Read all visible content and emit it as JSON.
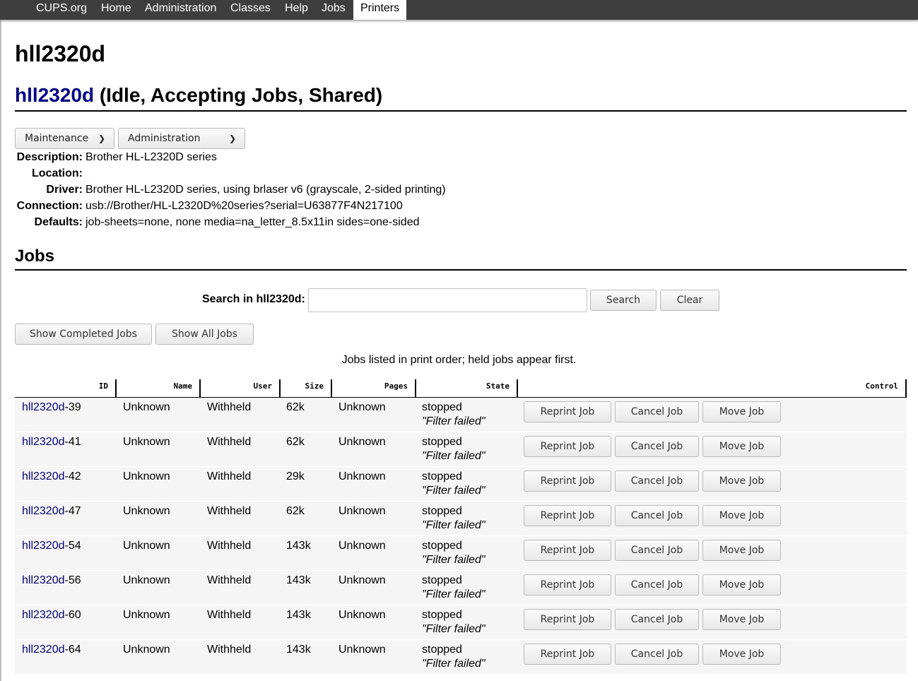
{
  "nav": {
    "items": [
      "CUPS.org",
      "Home",
      "Administration",
      "Classes",
      "Help",
      "Jobs",
      "Printers"
    ],
    "active": "Printers"
  },
  "page_title": "hll2320d",
  "printer": {
    "name": "hll2320d",
    "status": " (Idle, Accepting Jobs, Shared)"
  },
  "selects": {
    "maintenance": "Maintenance",
    "administration": "Administration"
  },
  "info": {
    "description_label": "Description:",
    "description": "Brother HL-L2320D series",
    "location_label": "Location:",
    "location": "",
    "driver_label": "Driver:",
    "driver": "Brother HL-L2320D series, using brlaser v6 (grayscale, 2-sided printing)",
    "connection_label": "Connection:",
    "connection": "usb://Brother/HL-L2320D%20series?serial=U63877F4N217100",
    "defaults_label": "Defaults:",
    "defaults": "job-sheets=none, none media=na_letter_8.5x11in sides=one-sided"
  },
  "jobs_heading": "Jobs",
  "search": {
    "label": "Search in hll2320d:",
    "value": "",
    "search_button": "Search",
    "clear_button": "Clear"
  },
  "show_completed_button": "Show Completed Jobs",
  "show_all_button": "Show All Jobs",
  "jobs_note": "Jobs listed in print order; held jobs appear first.",
  "table": {
    "headers": [
      "ID",
      "Name",
      "User",
      "Size",
      "Pages",
      "State",
      "Control"
    ],
    "rows": [
      {
        "id_prefix": "hll2320d",
        "id_num": "-39",
        "name": "Unknown",
        "user": "Withheld",
        "size": "62k",
        "pages": "Unknown",
        "state": "stopped",
        "state_msg": "\"Filter failed\""
      },
      {
        "id_prefix": "hll2320d",
        "id_num": "-41",
        "name": "Unknown",
        "user": "Withheld",
        "size": "62k",
        "pages": "Unknown",
        "state": "stopped",
        "state_msg": "\"Filter failed\""
      },
      {
        "id_prefix": "hll2320d",
        "id_num": "-42",
        "name": "Unknown",
        "user": "Withheld",
        "size": "29k",
        "pages": "Unknown",
        "state": "stopped",
        "state_msg": "\"Filter failed\""
      },
      {
        "id_prefix": "hll2320d",
        "id_num": "-47",
        "name": "Unknown",
        "user": "Withheld",
        "size": "62k",
        "pages": "Unknown",
        "state": "stopped",
        "state_msg": "\"Filter failed\""
      },
      {
        "id_prefix": "hll2320d",
        "id_num": "-54",
        "name": "Unknown",
        "user": "Withheld",
        "size": "143k",
        "pages": "Unknown",
        "state": "stopped",
        "state_msg": "\"Filter failed\""
      },
      {
        "id_prefix": "hll2320d",
        "id_num": "-56",
        "name": "Unknown",
        "user": "Withheld",
        "size": "143k",
        "pages": "Unknown",
        "state": "stopped",
        "state_msg": "\"Filter failed\""
      },
      {
        "id_prefix": "hll2320d",
        "id_num": "-60",
        "name": "Unknown",
        "user": "Withheld",
        "size": "143k",
        "pages": "Unknown",
        "state": "stopped",
        "state_msg": "\"Filter failed\""
      },
      {
        "id_prefix": "hll2320d",
        "id_num": "-64",
        "name": "Unknown",
        "user": "Withheld",
        "size": "143k",
        "pages": "Unknown",
        "state": "stopped",
        "state_msg": "\"Filter failed\""
      }
    ],
    "control_buttons": {
      "reprint": "Reprint Job",
      "cancel": "Cancel Job",
      "move": "Move Job"
    }
  },
  "colors": {
    "nav_bg": "#3e3e3e",
    "link": "#000099",
    "row_bg": "#f5f5f5"
  }
}
